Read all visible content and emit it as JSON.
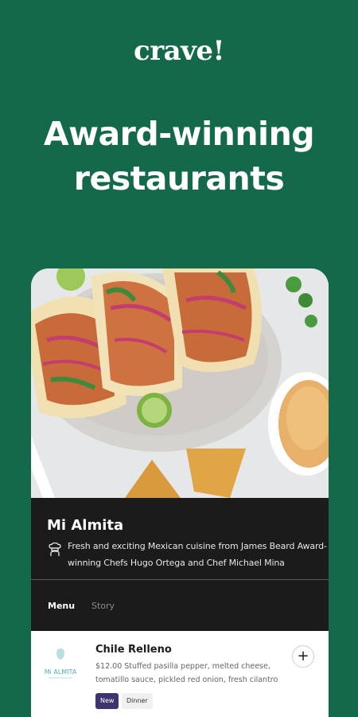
{
  "brand": {
    "logo_text": "crave!"
  },
  "headline": {
    "line1": "Award-winning",
    "line2": "restaurants"
  },
  "restaurant": {
    "name": "Mi Almita",
    "description": "Fresh and exciting Mexican cuisine from James Beard Award-winning Chefs Hugo Ortega and Chef Michael Mina"
  },
  "tabs": [
    {
      "label": "Menu",
      "active": true
    },
    {
      "label": "Story",
      "active": false
    }
  ],
  "menu_item": {
    "name": "Chile Relleno",
    "description": "$12.00 Stuffed pasilla pepper, melted cheese, tomatillo sauce, pickled red onion, fresh cilantro",
    "add_label": "+",
    "logo_text": "Mi ALMITA",
    "badges": [
      "New",
      "Dinner"
    ]
  },
  "colors": {
    "background": "#136949",
    "card_dark": "#1b1b1b",
    "badge_new": "#3d3470"
  },
  "icons": {
    "chef": "chef-hat-icon",
    "add": "plus-icon"
  }
}
